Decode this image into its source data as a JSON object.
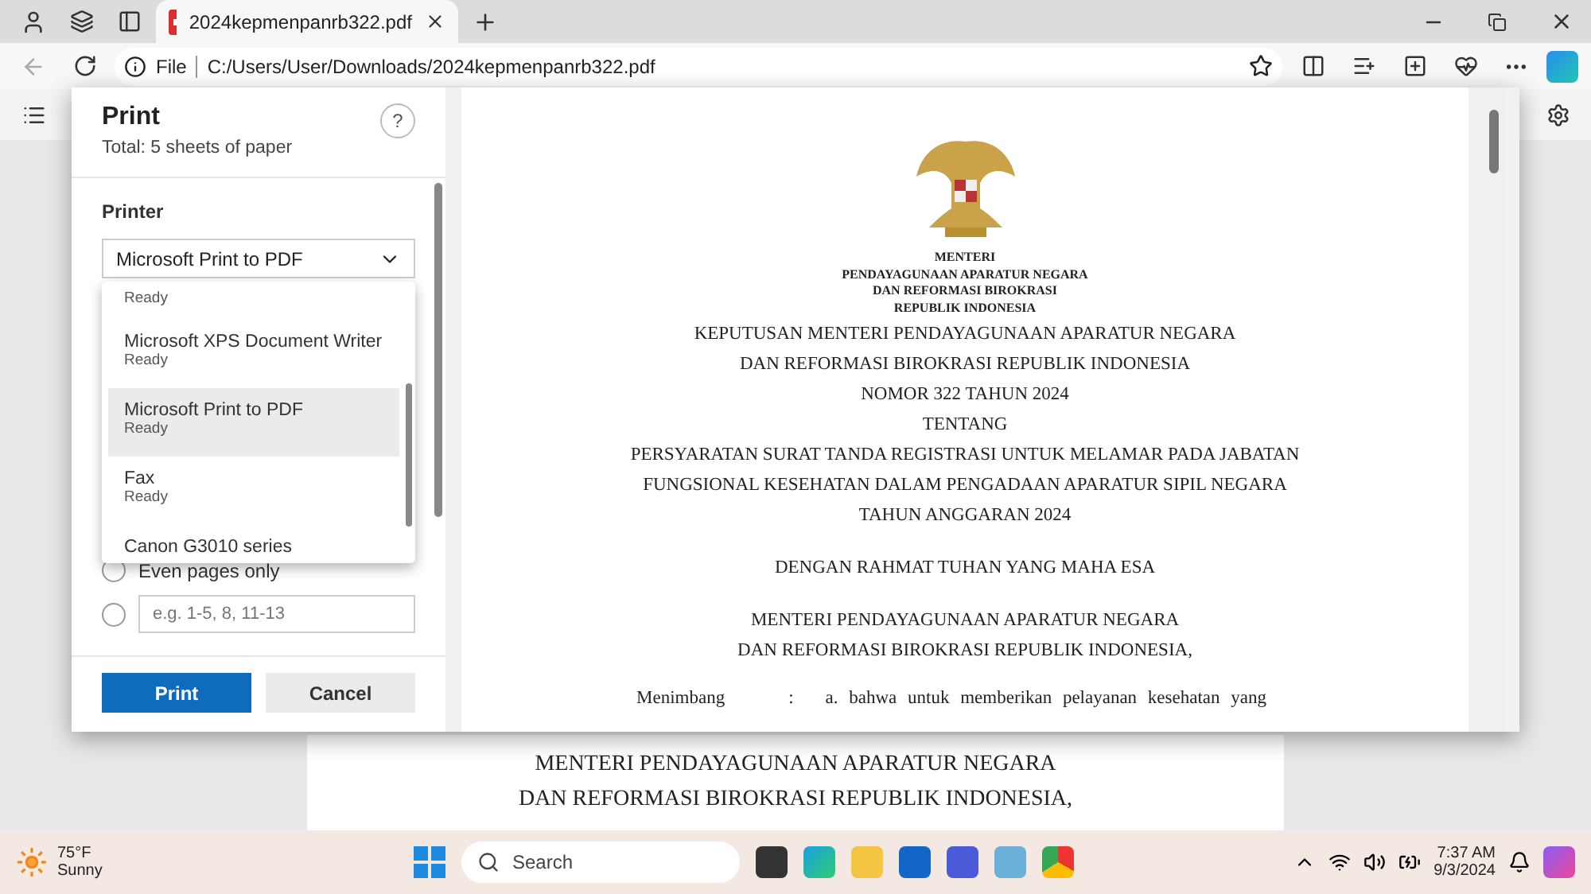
{
  "browser": {
    "tab": {
      "title": "2024kepmenpanrb322.pdf",
      "selected": true
    },
    "address": {
      "scheme": "File",
      "url": "C:/Users/User/Downloads/2024kepmenpanrb322.pdf"
    }
  },
  "print_dialog": {
    "title": "Print",
    "subtitle": "Total: 5 sheets of paper",
    "help": "?",
    "printer_label": "Printer",
    "printer_value": "Microsoft Print to PDF",
    "printer_options": [
      {
        "status": "Ready",
        "selected": false
      },
      {
        "name": "Microsoft XPS Document Writer",
        "status": "Ready",
        "selected": false
      },
      {
        "name": "Microsoft Print to PDF",
        "status": "Ready",
        "selected": true
      },
      {
        "name": "Fax",
        "status": "Ready",
        "selected": false
      },
      {
        "name": "Canon G3010 series",
        "selected": false
      }
    ],
    "page_options": [
      {
        "kind": "radio",
        "label": "Even pages only",
        "selected": false
      },
      {
        "kind": "range",
        "placeholder": "e.g. 1-5, 8, 11-13",
        "selected": false
      }
    ],
    "buttons": [
      {
        "label": "Print",
        "kind": "primary"
      },
      {
        "label": "Cancel",
        "kind": "secondary"
      }
    ]
  },
  "preview": {
    "letterhead": [
      "MENTERI",
      "PENDAYAGUNAAN APARATUR NEGARA",
      "DAN REFORMASI BIROKRASI",
      "REPUBLIK INDONESIA"
    ],
    "lines": [
      "KEPUTUSAN MENTERI PENDAYAGUNAAN APARATUR NEGARA",
      "DAN REFORMASI BIROKRASI REPUBLIK INDONESIA",
      "NOMOR 322 TAHUN 2024",
      "TENTANG",
      "PERSYARATAN SURAT TANDA REGISTRASI UNTUK MELAMAR PADA JABATAN",
      "FUNGSIONAL KESEHATAN DALAM PENGADAAN APARATUR SIPIL NEGARA",
      "TAHUN ANGGARAN 2024"
    ],
    "salutation": "DENGAN RAHMAT TUHAN YANG MAHA ESA",
    "minister": [
      "MENTERI PENDAYAGUNAAN APARATUR NEGARA",
      "DAN REFORMASI BIROKRASI REPUBLIK INDONESIA,"
    ],
    "consideration": {
      "label": "Menimbang",
      "colon": ":",
      "text": "a. bahwa untuk memberikan pelayanan kesehatan yang"
    }
  },
  "background_page": {
    "lines": [
      "MENTERI PENDAYAGUNAAN APARATUR NEGARA",
      "DAN REFORMASI BIROKRASI REPUBLIK INDONESIA,"
    ]
  },
  "taskbar": {
    "weather": {
      "temperature": "75°F",
      "condition": "Sunny"
    },
    "search_placeholder": "Search",
    "time": "7:37 AM",
    "date": "9/3/2024"
  }
}
